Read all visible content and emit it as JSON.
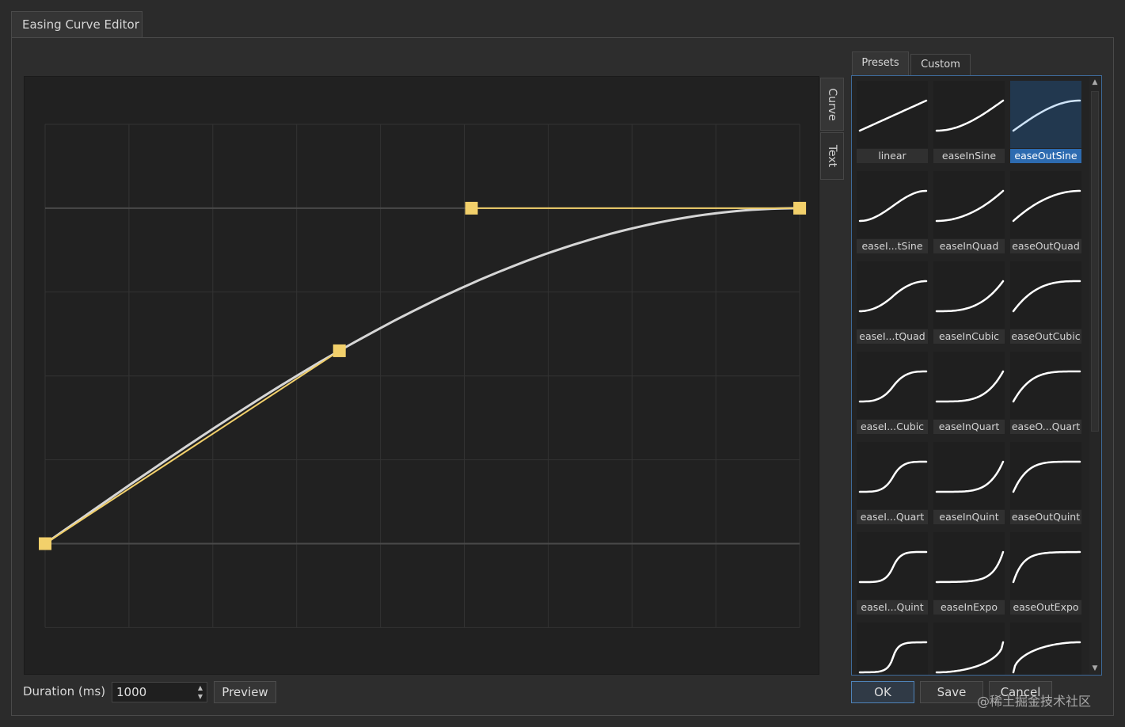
{
  "window": {
    "tab_title": "Easing Curve Editor"
  },
  "side_tabs": [
    {
      "label": "Curve",
      "active": true
    },
    {
      "label": "Text",
      "active": false
    }
  ],
  "preset_tabs": [
    {
      "label": "Presets",
      "active": true
    },
    {
      "label": "Custom",
      "active": false
    }
  ],
  "curve_editor": {
    "curve_color": "#d6d6d6",
    "handle_color": "#f2d06b",
    "grid_color": "#333333",
    "baseline_color": "#4a4a4a"
  },
  "presets": [
    {
      "label": "linear",
      "curve": "linear",
      "selected": false
    },
    {
      "label": "easeInSine",
      "curve": "easeInSine",
      "selected": false
    },
    {
      "label": "easeOutSine",
      "curve": "easeOutSine",
      "selected": true
    },
    {
      "label": "easeI...tSine",
      "curve": "easeInOutSine",
      "selected": false
    },
    {
      "label": "easeInQuad",
      "curve": "easeInQuad",
      "selected": false
    },
    {
      "label": "easeOutQuad",
      "curve": "easeOutQuad",
      "selected": false
    },
    {
      "label": "easeI...tQuad",
      "curve": "easeInOutQuad",
      "selected": false
    },
    {
      "label": "easeInCubic",
      "curve": "easeInCubic",
      "selected": false
    },
    {
      "label": "easeOutCubic",
      "curve": "easeOutCubic",
      "selected": false
    },
    {
      "label": "easeI...Cubic",
      "curve": "easeInOutCubic",
      "selected": false
    },
    {
      "label": "easeInQuart",
      "curve": "easeInQuart",
      "selected": false
    },
    {
      "label": "easeO...Quart",
      "curve": "easeOutQuart",
      "selected": false
    },
    {
      "label": "easeI...Quart",
      "curve": "easeInOutQuart",
      "selected": false
    },
    {
      "label": "easeInQuint",
      "curve": "easeInQuint",
      "selected": false
    },
    {
      "label": "easeOutQuint",
      "curve": "easeOutQuint",
      "selected": false
    },
    {
      "label": "easeI...Quint",
      "curve": "easeInOutQuint",
      "selected": false
    },
    {
      "label": "easeInExpo",
      "curve": "easeInExpo",
      "selected": false
    },
    {
      "label": "easeOutExpo",
      "curve": "easeOutExpo",
      "selected": false
    },
    {
      "label": "",
      "curve": "easeInOutExpo",
      "selected": false
    },
    {
      "label": "",
      "curve": "easeInCirc",
      "selected": false
    },
    {
      "label": "",
      "curve": "easeOutCirc",
      "selected": false
    }
  ],
  "duration": {
    "label": "Duration (ms)",
    "value": "1000"
  },
  "buttons": {
    "preview": "Preview",
    "ok": "OK",
    "save": "Save",
    "cancel": "Cancel"
  },
  "watermark": "@稀土掘金技术社区",
  "icons": {
    "spin_up": "spin-up-arrow-icon",
    "spin_down": "spin-down-arrow-icon",
    "scroll_up": "scroll-up-arrow-icon",
    "scroll_down": "scroll-down-arrow-icon"
  }
}
